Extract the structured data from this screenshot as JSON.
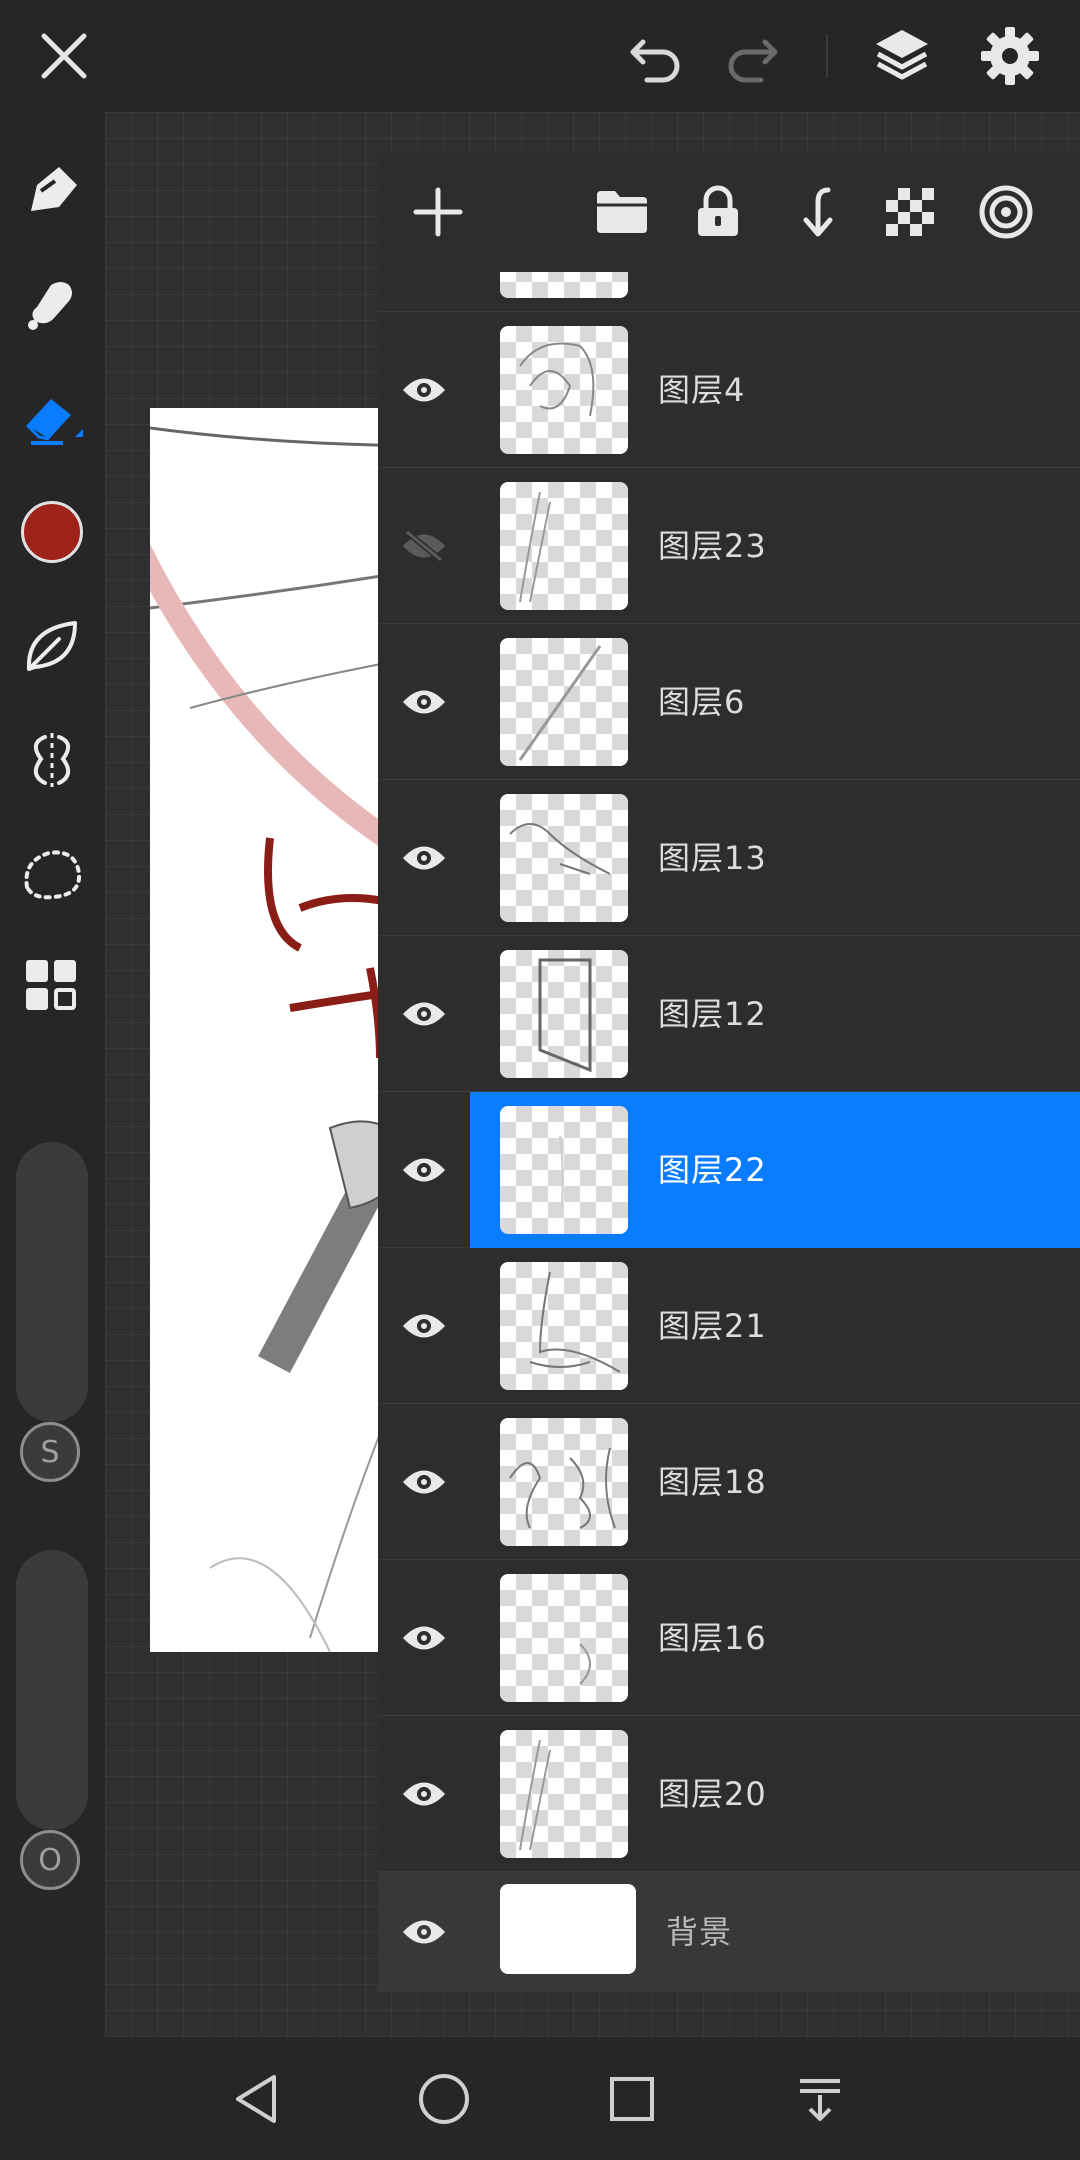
{
  "app": {
    "topbar": {
      "close_icon": "close-icon",
      "undo_icon": "undo-icon",
      "redo_icon": "redo-icon",
      "layers_icon": "layers-icon",
      "settings_icon": "gear-icon"
    },
    "tools": [
      {
        "name": "pen-tool",
        "icon": "pen-icon"
      },
      {
        "name": "smudge-tool",
        "icon": "smudge-icon"
      },
      {
        "name": "eraser-tool",
        "icon": "eraser-icon",
        "active": true
      },
      {
        "name": "color-swatch",
        "color": "#9e2219"
      },
      {
        "name": "brush-library",
        "icon": "leaf-icon"
      },
      {
        "name": "symmetry-tool",
        "icon": "symmetry-icon"
      },
      {
        "name": "lasso-tool",
        "icon": "lasso-icon"
      },
      {
        "name": "gallery-tool",
        "icon": "grid-icon"
      }
    ],
    "size_slider": {
      "label": "S"
    },
    "opacity_slider": {
      "label": "O"
    },
    "colors": {
      "accent": "#0a7cff",
      "brush_color": "#9e2219"
    }
  },
  "layer_panel": {
    "header_icons": [
      "add-layer-icon",
      "folder-icon",
      "lock-icon",
      "merge-down-icon",
      "transparency-icon",
      "blend-icon"
    ],
    "layers": [
      {
        "name": "图层4",
        "visible": true,
        "selected": false
      },
      {
        "name": "图层23",
        "visible": false,
        "selected": false
      },
      {
        "name": "图层6",
        "visible": true,
        "selected": false
      },
      {
        "name": "图层13",
        "visible": true,
        "selected": false
      },
      {
        "name": "图层12",
        "visible": true,
        "selected": false
      },
      {
        "name": "图层22",
        "visible": true,
        "selected": true
      },
      {
        "name": "图层21",
        "visible": true,
        "selected": false
      },
      {
        "name": "图层18",
        "visible": true,
        "selected": false
      },
      {
        "name": "图层16",
        "visible": true,
        "selected": false
      },
      {
        "name": "图层20",
        "visible": true,
        "selected": false
      }
    ],
    "background_layer": {
      "name": "背景",
      "visible": true
    }
  },
  "navbar": {
    "icons": [
      "back-icon",
      "home-icon",
      "recents-icon",
      "notification-pull-icon"
    ]
  }
}
